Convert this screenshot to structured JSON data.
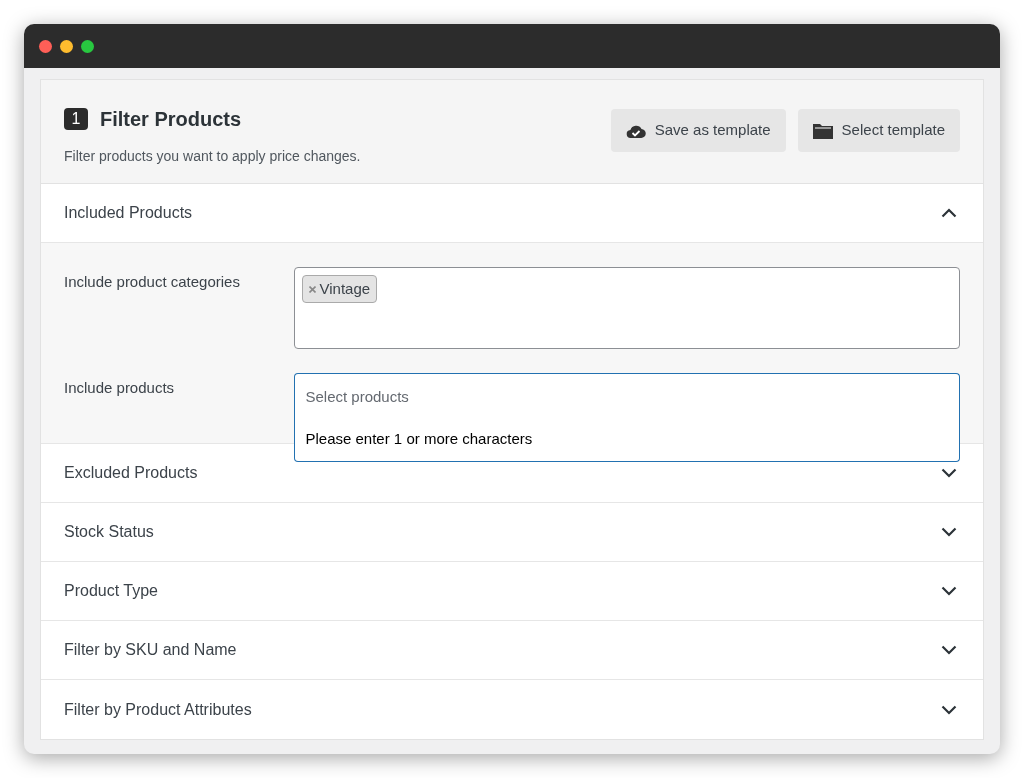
{
  "header": {
    "step": "1",
    "title": "Filter Products",
    "subtitle": "Filter products you want to apply price changes.",
    "buttons": [
      {
        "label": "Save as template"
      },
      {
        "label": "Select template"
      }
    ]
  },
  "sections": [
    {
      "title": "Included Products",
      "expanded": true,
      "fields": [
        {
          "kind": "tags",
          "label": "Include product categories",
          "tags": [
            "Vintage"
          ]
        },
        {
          "kind": "select",
          "label": "Include products",
          "placeholder": "Select products",
          "open": true,
          "message": "Please enter 1 or more characters"
        }
      ]
    },
    {
      "title": "Excluded Products",
      "expanded": false
    },
    {
      "title": "Stock Status",
      "expanded": false
    },
    {
      "title": "Product Type",
      "expanded": false
    },
    {
      "title": "Filter by SKU and Name",
      "expanded": false
    },
    {
      "title": "Filter by Product Attributes",
      "expanded": false
    }
  ]
}
